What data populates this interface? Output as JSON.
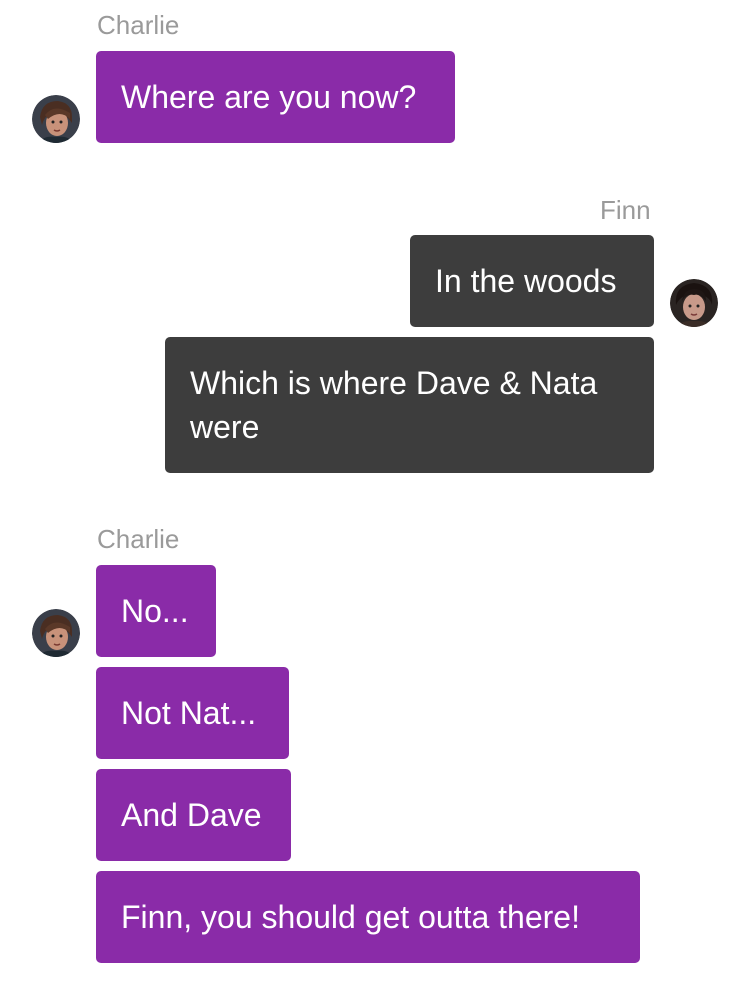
{
  "colors": {
    "charlie_bubble": "#8a2ba8",
    "finn_bubble": "#3d3d3d",
    "name_text": "#9a9a9a",
    "bubble_text": "#ffffff"
  },
  "groups": [
    {
      "sender": "Charlie",
      "side": "left",
      "avatar_icon": "charlie-avatar-icon",
      "messages": [
        "Where are you now?"
      ]
    },
    {
      "sender": "Finn",
      "side": "right",
      "avatar_icon": "finn-avatar-icon",
      "messages": [
        "In the woods",
        "Which is where Dave & Nata were"
      ]
    },
    {
      "sender": "Charlie",
      "side": "left",
      "avatar_icon": "charlie-avatar-icon",
      "messages": [
        "No...",
        "Not Nat...",
        "And Dave",
        "Finn, you should get outta there!"
      ]
    }
  ]
}
